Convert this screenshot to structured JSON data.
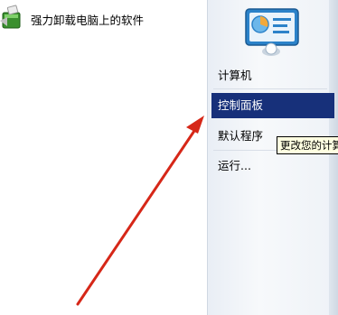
{
  "programs": {
    "items": [
      {
        "label": "强力卸载电脑上的软件",
        "icon": "uninstaller-icon"
      }
    ]
  },
  "start_menu": {
    "logo_icon": "control-panel-icon",
    "items": [
      {
        "label": "计算机",
        "selected": false
      },
      {
        "label": "控制面板",
        "selected": true
      },
      {
        "label": "默认程序",
        "selected": false
      },
      {
        "label": "运行...",
        "selected": false
      }
    ]
  },
  "tooltip": {
    "text": "更改您的计算"
  },
  "annotation": {
    "arrow_color": "#d62718"
  },
  "colors": {
    "selection": "#17307a",
    "tooltip_bg": "#ffffe1"
  }
}
